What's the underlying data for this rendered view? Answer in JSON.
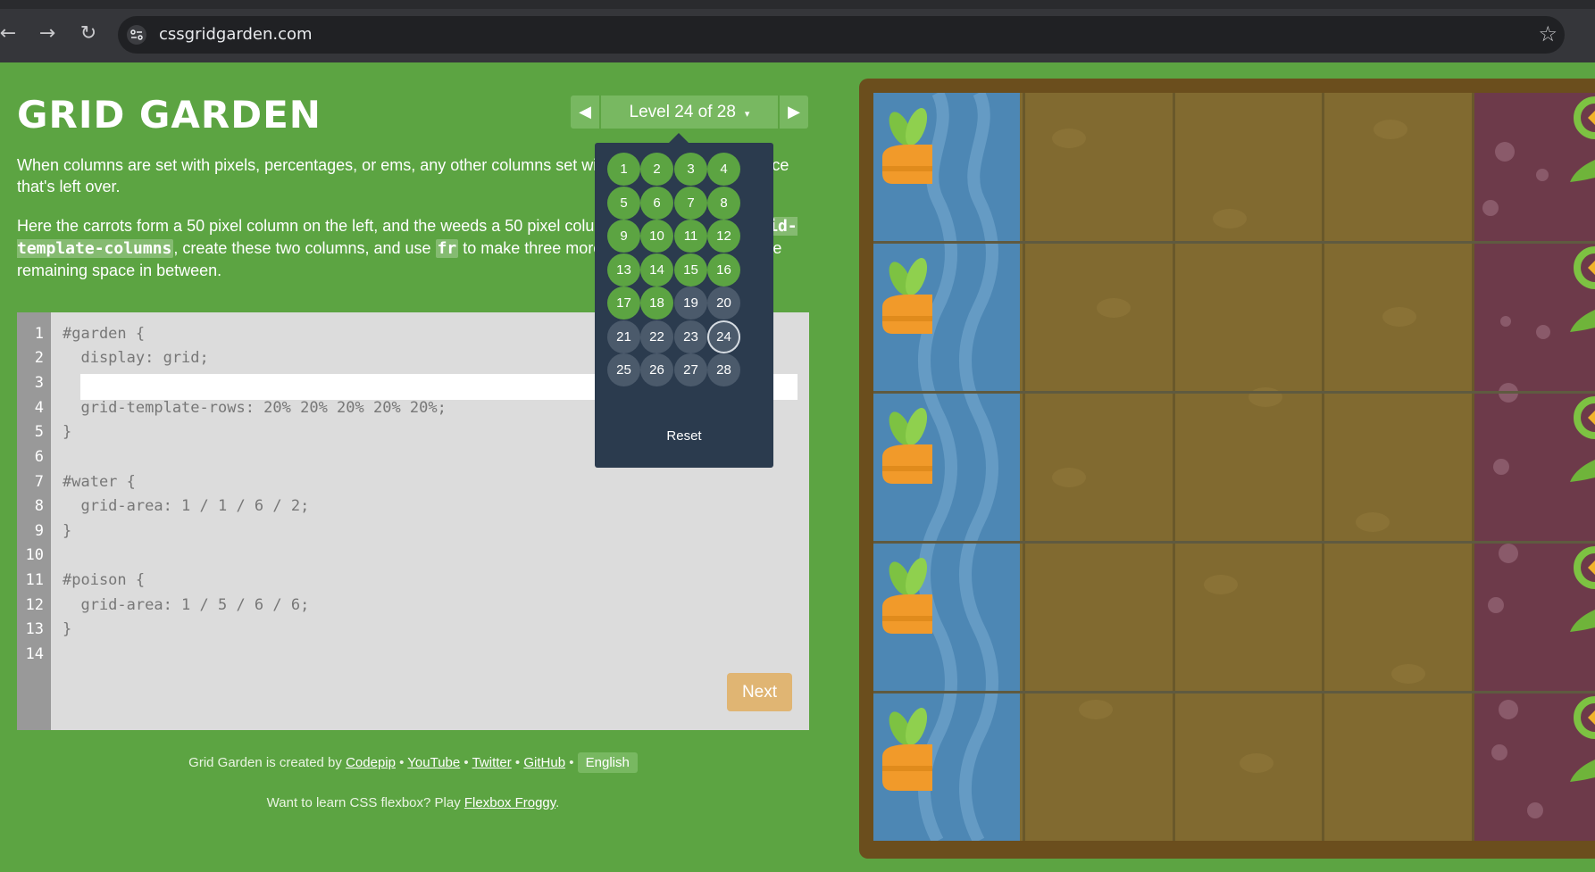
{
  "browser": {
    "url": "cssgridgarden.com",
    "back_icon": "arrow-left",
    "forward_icon": "arrow-right",
    "reload_icon": "reload",
    "bookmark_icon": "star"
  },
  "page": {
    "logo": "GRID GARDEN",
    "level_selector": {
      "prev": "◀",
      "label": "Level 24 of 28",
      "caret": "▾",
      "next": "▶"
    },
    "instructions": {
      "p1": "When columns are set with pixels, percentages, or ems, any other columns set with fr will divvy up the space that's left over.",
      "p2_parts": [
        "Here the carrots form a 50 pixel column on the left, and the weeds a 50 pixel column on the right. With ",
        "grid-template-columns",
        ", create these two columns, and use ",
        "fr",
        " to make three more columns that take up the remaining space in between."
      ]
    },
    "editor": {
      "line_numbers": [
        "1",
        "2",
        "3",
        "4",
        "5",
        "6",
        "7",
        "8",
        "9",
        "10",
        "11",
        "12",
        "13",
        "14"
      ],
      "lines": [
        "#garden {",
        "  display: grid;",
        "",
        "  grid-template-rows: 20% 20% 20% 20% 20%;",
        "}",
        "",
        "#water {",
        "  grid-area: 1 / 1 / 6 / 2;",
        "}",
        "",
        "#poison {",
        "  grid-area: 1 / 5 / 6 / 6;",
        "}",
        ""
      ],
      "input_value": "",
      "next_label": "Next"
    },
    "credits": {
      "prefix": "Grid Garden is created by ",
      "codepip": "Codepip",
      "sep1": " • ",
      "youtube": "YouTube",
      "sep2": " • ",
      "twitter": "Twitter",
      "sep3": " • ",
      "github": "GitHub",
      "sep4": " • ",
      "language": "English"
    },
    "froggy": {
      "prefix": "Want to learn CSS flexbox? Play ",
      "link": "Flexbox Froggy",
      "suffix": "."
    }
  },
  "levels_menu": {
    "levels": [
      {
        "n": "1",
        "state": "solved"
      },
      {
        "n": "2",
        "state": "solved"
      },
      {
        "n": "3",
        "state": "solved"
      },
      {
        "n": "4",
        "state": "solved"
      },
      {
        "n": "5",
        "state": "solved"
      },
      {
        "n": "6",
        "state": "solved"
      },
      {
        "n": "7",
        "state": "solved"
      },
      {
        "n": "8",
        "state": "solved"
      },
      {
        "n": "9",
        "state": "solved"
      },
      {
        "n": "10",
        "state": "solved"
      },
      {
        "n": "11",
        "state": "solved"
      },
      {
        "n": "12",
        "state": "solved"
      },
      {
        "n": "13",
        "state": "solved"
      },
      {
        "n": "14",
        "state": "solved"
      },
      {
        "n": "15",
        "state": "solved"
      },
      {
        "n": "16",
        "state": "solved"
      },
      {
        "n": "17",
        "state": "solved"
      },
      {
        "n": "18",
        "state": "solved"
      },
      {
        "n": "19",
        "state": "unsolved"
      },
      {
        "n": "20",
        "state": "unsolved"
      },
      {
        "n": "21",
        "state": "unsolved"
      },
      {
        "n": "22",
        "state": "unsolved"
      },
      {
        "n": "23",
        "state": "unsolved"
      },
      {
        "n": "24",
        "state": "current"
      },
      {
        "n": "25",
        "state": "unsolved"
      },
      {
        "n": "26",
        "state": "unsolved"
      },
      {
        "n": "27",
        "state": "unsolved"
      },
      {
        "n": "28",
        "state": "unsolved"
      }
    ],
    "reset_label": "Reset"
  },
  "colors": {
    "page_bg": "#5ca442",
    "accent": "#78b861",
    "next_button": "#e0b573",
    "menu_bg": "#2b3b4e",
    "water": "#4d87b4",
    "soil": "#816a30",
    "poison": "#6d3a4a"
  }
}
